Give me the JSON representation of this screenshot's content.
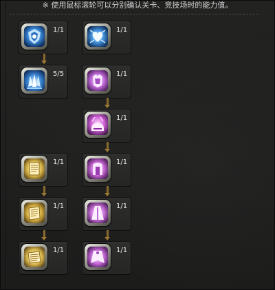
{
  "header": {
    "tip_text": "※ 使用鼠标滚轮可以分别确认关卡、竞技场时的能力值。"
  },
  "colors": {
    "background": "#1e1e1d",
    "panel": "#2b2b2a",
    "arrow": "#8a6a2c",
    "blue_icon": "#3d8ee0",
    "pink_icon": "#c06ad8",
    "gold_icon": "#d9b64a"
  },
  "skills": [
    {
      "id": "blue-crest",
      "icon": "blue-crest-icon",
      "theme": "blue",
      "level": "1/1"
    },
    {
      "id": "blue-heart",
      "icon": "blue-heart-icon",
      "theme": "blue",
      "level": "1/1"
    },
    {
      "id": "blue-crystal",
      "icon": "blue-crystal-icon",
      "theme": "blue",
      "level": "5/5"
    },
    {
      "id": "pink-armor",
      "icon": "pink-armor-icon",
      "theme": "pink",
      "level": "1/1"
    },
    {
      "id": "pink-helm",
      "icon": "pink-helm-icon",
      "theme": "pink",
      "level": "1/1"
    },
    {
      "id": "gold-scroll-1",
      "icon": "gold-scroll-icon",
      "theme": "gold",
      "level": "1/1"
    },
    {
      "id": "pink-gate",
      "icon": "pink-gate-icon",
      "theme": "pink",
      "level": "1/1"
    },
    {
      "id": "gold-scroll-2",
      "icon": "gold-scroll-icon",
      "theme": "gold",
      "level": "1/1"
    },
    {
      "id": "pink-robe",
      "icon": "pink-robe-icon",
      "theme": "pink",
      "level": "1/1"
    },
    {
      "id": "gold-scroll-3",
      "icon": "gold-scroll-icon",
      "theme": "gold",
      "level": "1/1"
    },
    {
      "id": "pink-cape",
      "icon": "pink-cape-icon",
      "theme": "pink",
      "level": "1/1"
    }
  ]
}
